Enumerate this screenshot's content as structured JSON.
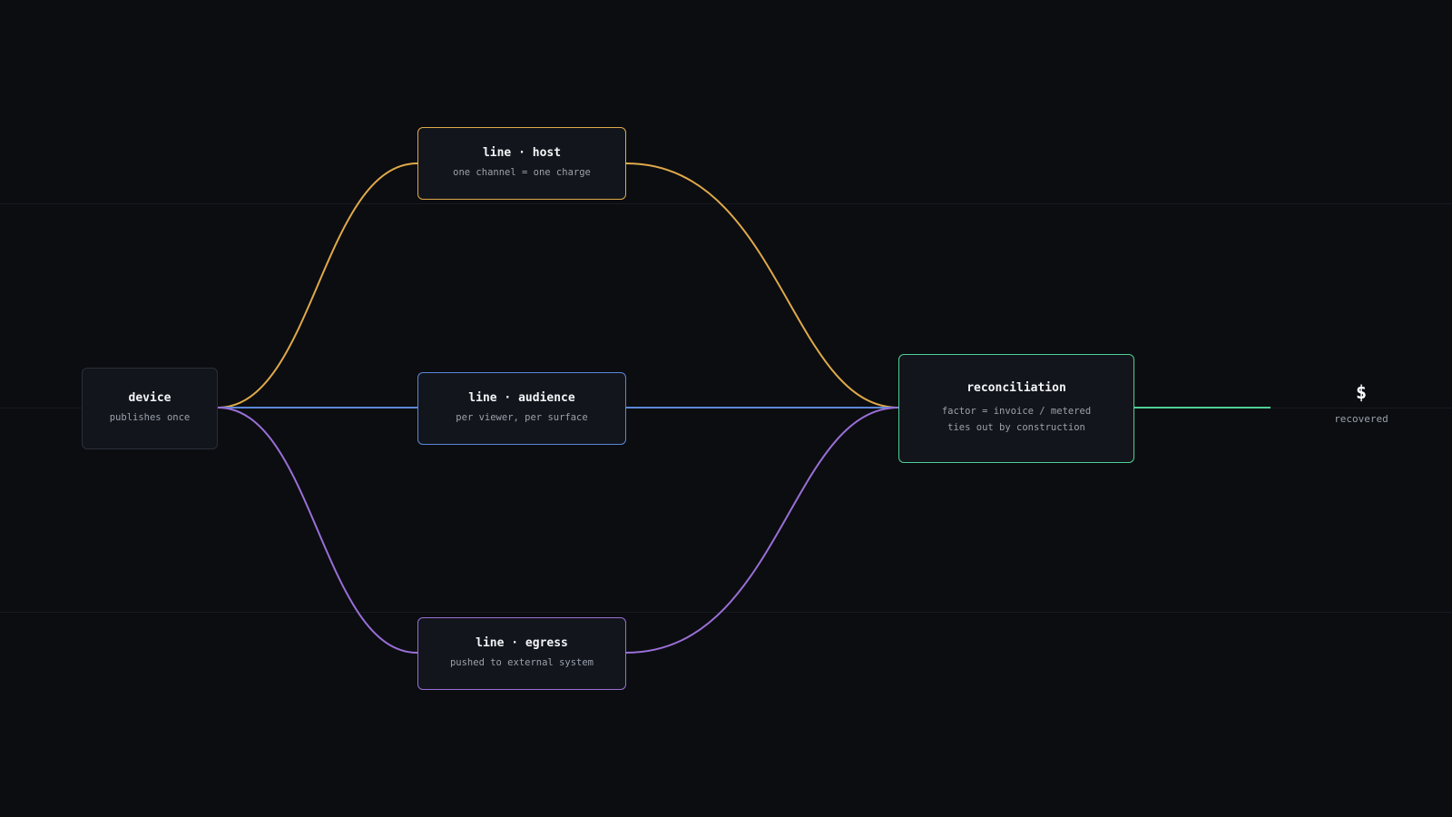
{
  "colors": {
    "background": "#0b0d11",
    "host": "#e0a94a",
    "audience": "#5b88d8",
    "egress": "#9a6fd6",
    "reconciliation": "#4fcf95",
    "device_border": "#2a2f38"
  },
  "nodes": {
    "device": {
      "title": "device",
      "sub": "publishes once"
    },
    "host": {
      "title": "line · host",
      "sub": "one channel = one charge"
    },
    "audience": {
      "title": "line · audience",
      "sub": "per viewer, per surface"
    },
    "egress": {
      "title": "line · egress",
      "sub": "pushed to external system"
    },
    "reconciliation": {
      "title": "reconciliation",
      "sub_line1": "factor = invoice / metered",
      "sub_line2": "ties out by construction"
    }
  },
  "output": {
    "symbol": "$",
    "label": "recovered"
  }
}
